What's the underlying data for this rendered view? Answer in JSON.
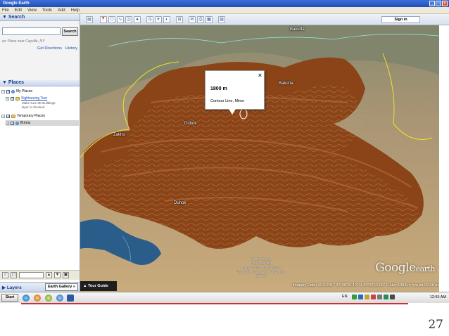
{
  "window": {
    "title": "Google Earth"
  },
  "menu": [
    "File",
    "Edit",
    "View",
    "Tools",
    "Add",
    "Help"
  ],
  "search": {
    "header": "Search",
    "button_label": "Search",
    "hint": "ex: Pizza near Cayville, NY",
    "links": [
      "Get Directions",
      "History"
    ]
  },
  "places": {
    "header": "Places",
    "my_places": "My Places",
    "sightseeing_tour": "Sightseeing Tour",
    "note_line1": "Make sure 3D Buildings",
    "note_line2": "layer is checked",
    "temporary_places": "Temporary Places",
    "file": "ffl.kmz"
  },
  "layers": {
    "label": "Layers",
    "gallery_button": "Earth Gallery »"
  },
  "toolbar": {
    "sign_in": "Sign in"
  },
  "map": {
    "place_labels": [
      "Bakurta",
      "Zakho",
      "Duhok",
      "Duhok",
      "Bakurta"
    ],
    "popup": {
      "title": "1800 m",
      "description": "Contour Line, Minor",
      "close": "×"
    },
    "tour_guide": "▲ Tour Guide",
    "logo_main": "Google",
    "logo_sub": "earth",
    "attribution": [
      "© 2017 Google",
      "Image Landsat",
      "Image © 2017 DigitalGlobe",
      "Data SIO, NOAA, U.S. Navy, NGA, GEBCO"
    ],
    "status": "Imagery Date: 4/10/2017   37°08'39.40\" N   43°20'12.05\" E  elev 1383 m   eye alt 92.46 mi"
  },
  "taskbar": {
    "start": "Start",
    "language": "EN",
    "clock": "12:55 AM"
  },
  "slide": {
    "number": "27"
  },
  "colors": {
    "contour_brown": "#8a4418",
    "terrain_tan": "#c2a276",
    "lake_blue": "#2a5d8a",
    "border_yellow": "#f0e030",
    "border_teal": "#8fe0d8"
  }
}
